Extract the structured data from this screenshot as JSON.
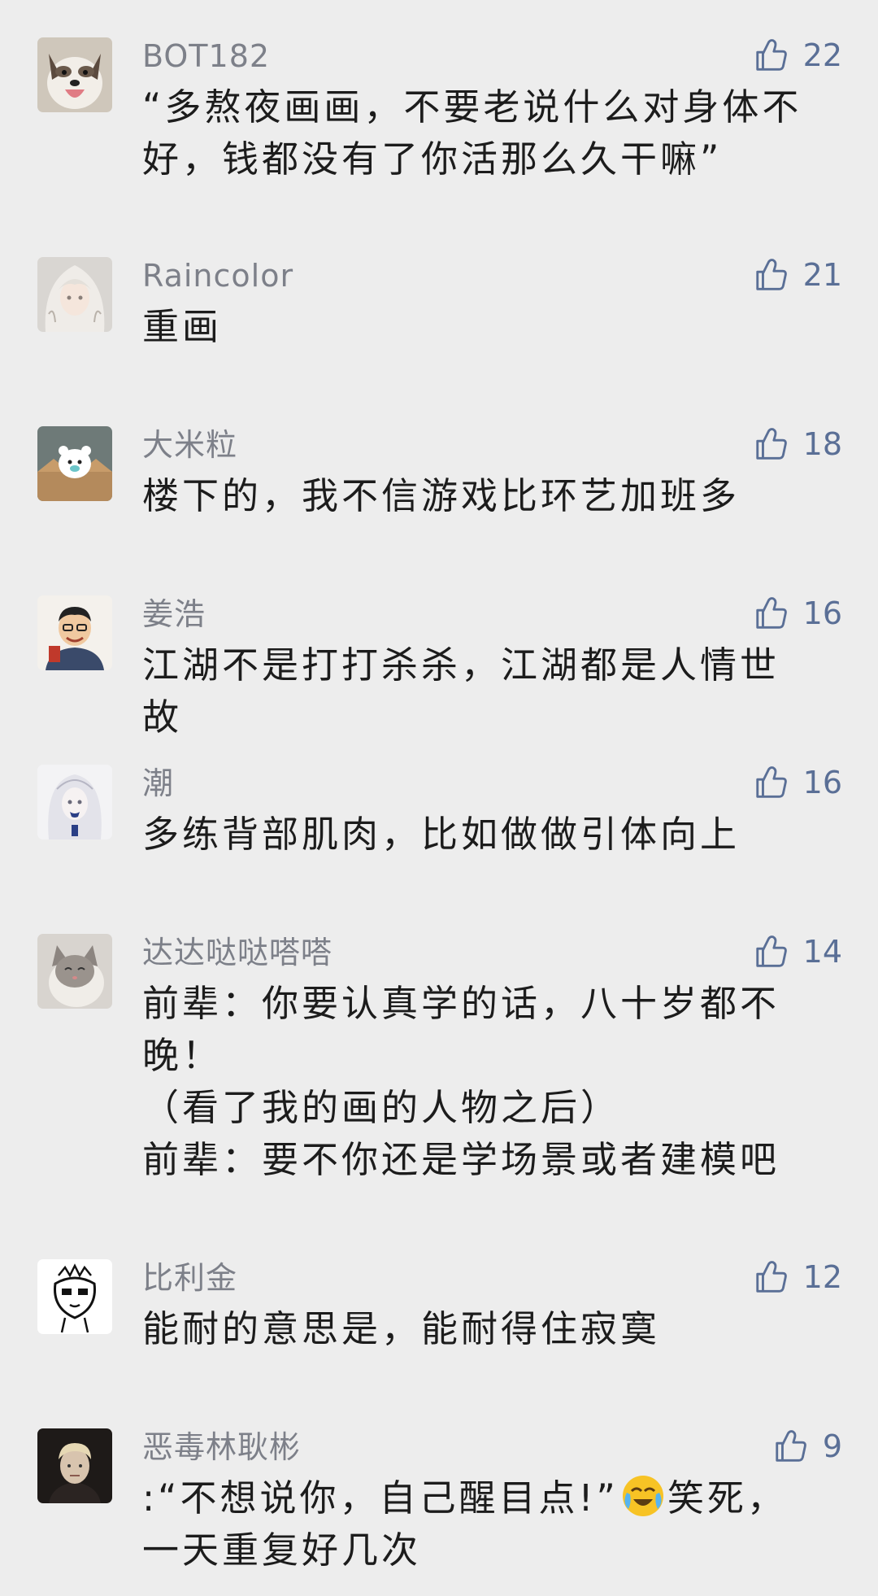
{
  "comments": [
    {
      "username": "BOT182",
      "likes": "22",
      "text": "“多熬夜画画，不要老说什么对身体不好，钱都没有了你活那么久干嘛”",
      "avatar": "dog-avatar"
    },
    {
      "username": "Raincolor",
      "likes": "21",
      "text": "重画",
      "avatar": "anime-white-hair-avatar"
    },
    {
      "username": "大米粒",
      "likes": "18",
      "text": "楼下的，我不信游戏比环艺加班多",
      "avatar": "bear-box-avatar"
    },
    {
      "username": "姜浩",
      "likes": "16",
      "text": "江湖不是打打杀杀，江湖都是人情世故",
      "avatar": "cartoon-man-avatar"
    },
    {
      "username": "潮",
      "likes": "16",
      "text": "多练背部肌肉，比如做做引体向上",
      "avatar": "sketch-girl-avatar"
    },
    {
      "username": "达达哒哒嗒嗒",
      "likes": "14",
      "text": "前辈：你要认真学的话，八十岁都不晚！\n（看了我的画的人物之后）\n前辈：要不你还是学场景或者建模吧",
      "avatar": "cat-avatar"
    },
    {
      "username": "比利金",
      "likes": "12",
      "text": "能耐的意思是，能耐得住寂寞",
      "avatar": "line-drawing-avatar"
    },
    {
      "username": "恶毒林耿彬",
      "likes": "9",
      "text_before": ":“不想说你，自己醒目点!”",
      "emoji": "loudly-crying-laughing-emoji",
      "text_after": "笑死，一天重复好几次",
      "avatar": "blond-man-avatar"
    }
  ],
  "colors": {
    "background": "#ededed",
    "username": "#7d8089",
    "like_icon": "#5a6f96",
    "text": "#1c1c1c"
  }
}
